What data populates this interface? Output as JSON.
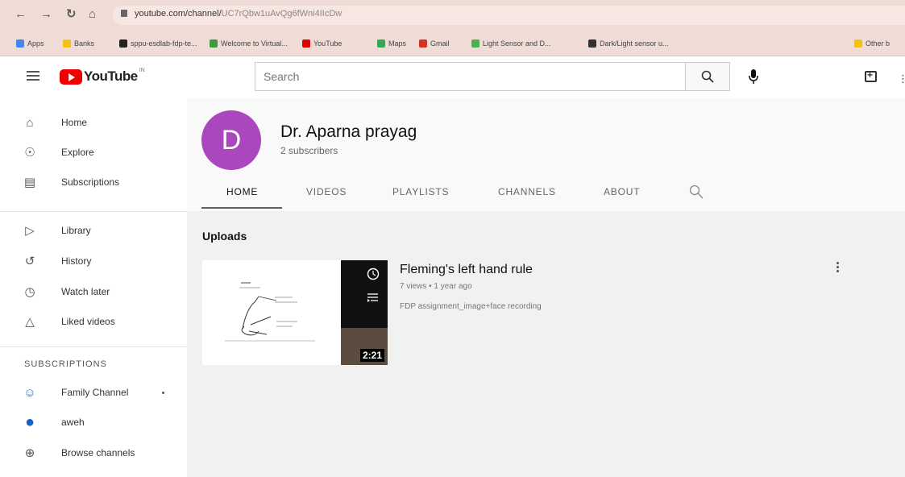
{
  "browser": {
    "url_host": "youtube.com/channel/",
    "url_path": "UC7rQbw1uAvQg6fWni4IIcDw",
    "bookmarks": [
      {
        "label": "Apps",
        "icon": "apps-grid-icon",
        "color": "#4285f4"
      },
      {
        "label": "Banks",
        "icon": "folder-icon",
        "color": "#f4c20d"
      },
      {
        "label": "sppu-esdlab-fdp-te...",
        "icon": "github-icon",
        "color": "#222222"
      },
      {
        "label": "Welcome to Virtual...",
        "icon": "virtual-lab-icon",
        "color": "#3c9a3c"
      },
      {
        "label": "YouTube",
        "icon": "youtube-icon",
        "color": "#e00000"
      },
      {
        "label": "Maps",
        "icon": "maps-icon",
        "color": "#34a853"
      },
      {
        "label": "Gmail",
        "icon": "gmail-icon",
        "color": "#d93025"
      },
      {
        "label": "Light Sensor and D...",
        "icon": "globe-icon",
        "color": "#4caf50"
      },
      {
        "label": "Dark/Light sensor u...",
        "icon": "table-icon",
        "color": "#333333"
      },
      {
        "label": "Other b",
        "icon": "folder-icon",
        "color": "#f4c20d"
      }
    ]
  },
  "header": {
    "logo_text": "YouTube",
    "logo_sup": "IN",
    "search_placeholder": "Search"
  },
  "sidebar": {
    "main": [
      {
        "label": "Home",
        "icon": "home-icon"
      },
      {
        "label": "Explore",
        "icon": "explore-compass-icon"
      },
      {
        "label": "Subscriptions",
        "icon": "subscriptions-icon"
      }
    ],
    "library": [
      {
        "label": "Library",
        "icon": "library-icon"
      },
      {
        "label": "History",
        "icon": "history-icon"
      },
      {
        "label": "Watch later",
        "icon": "watch-later-clock-icon"
      },
      {
        "label": "Liked videos",
        "icon": "thumbs-up-icon"
      }
    ],
    "subscriptions_heading": "SUBSCRIPTIONS",
    "subscriptions": [
      {
        "label": "Family Channel",
        "icon": "family-channel-icon"
      },
      {
        "label": "aweh",
        "icon": "channel-avatar-icon"
      },
      {
        "label": "Browse channels",
        "icon": "browse-plus-icon"
      }
    ]
  },
  "channel": {
    "avatar_letter": "D",
    "avatar_color": "#ab47bc",
    "name": "Dr. Aparna prayag",
    "subscribers": "2 subscribers",
    "tabs": [
      "HOME",
      "VIDEOS",
      "PLAYLISTS",
      "CHANNELS",
      "ABOUT"
    ],
    "active_tab": "HOME"
  },
  "uploads": {
    "heading": "Uploads",
    "video": {
      "title": "Fleming's left hand rule",
      "meta": "7 views • 1 year ago",
      "description": "FDP assignment_image+face recording",
      "duration": "2:21"
    }
  }
}
